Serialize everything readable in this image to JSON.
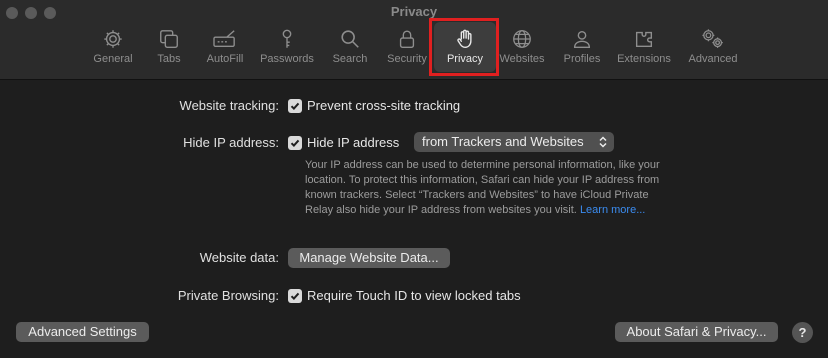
{
  "window": {
    "title": "Privacy"
  },
  "tabs": [
    {
      "label": "General",
      "icon": "gear-icon"
    },
    {
      "label": "Tabs",
      "icon": "tabs-icon"
    },
    {
      "label": "AutoFill",
      "icon": "autofill-icon"
    },
    {
      "label": "Passwords",
      "icon": "key-icon"
    },
    {
      "label": "Search",
      "icon": "search-icon"
    },
    {
      "label": "Security",
      "icon": "lock-icon"
    },
    {
      "label": "Privacy",
      "icon": "hand-icon",
      "selected": true
    },
    {
      "label": "Websites",
      "icon": "globe-icon"
    },
    {
      "label": "Profiles",
      "icon": "person-icon"
    },
    {
      "label": "Extensions",
      "icon": "puzzle-icon"
    },
    {
      "label": "Advanced",
      "icon": "gears-icon"
    }
  ],
  "settings": {
    "tracking": {
      "label": "Website tracking:",
      "checkbox_label": "Prevent cross-site tracking",
      "checked": true
    },
    "hide_ip": {
      "label": "Hide IP address:",
      "checkbox_label": "Hide IP address",
      "checked": true,
      "selected_option": "from Trackers and Websites",
      "description": "Your IP address can be used to determine personal information, like your location. To protect this information, Safari can hide your IP address from known trackers. Select “Trackers and Websites” to have iCloud Private Relay also hide your IP address from websites you visit.",
      "learn_more": "Learn more..."
    },
    "website_data": {
      "label": "Website data:",
      "button_label": "Manage Website Data..."
    },
    "private_browsing": {
      "label": "Private Browsing:",
      "checkbox_label": "Require Touch ID to view locked tabs",
      "checked": true
    }
  },
  "footer": {
    "advanced_button": "Advanced Settings",
    "about_button": "About Safari & Privacy...",
    "help_button": "?"
  },
  "colors": {
    "accent_link": "#3b8cf0",
    "highlight": "#e02020",
    "background": "#1e1e1e"
  }
}
